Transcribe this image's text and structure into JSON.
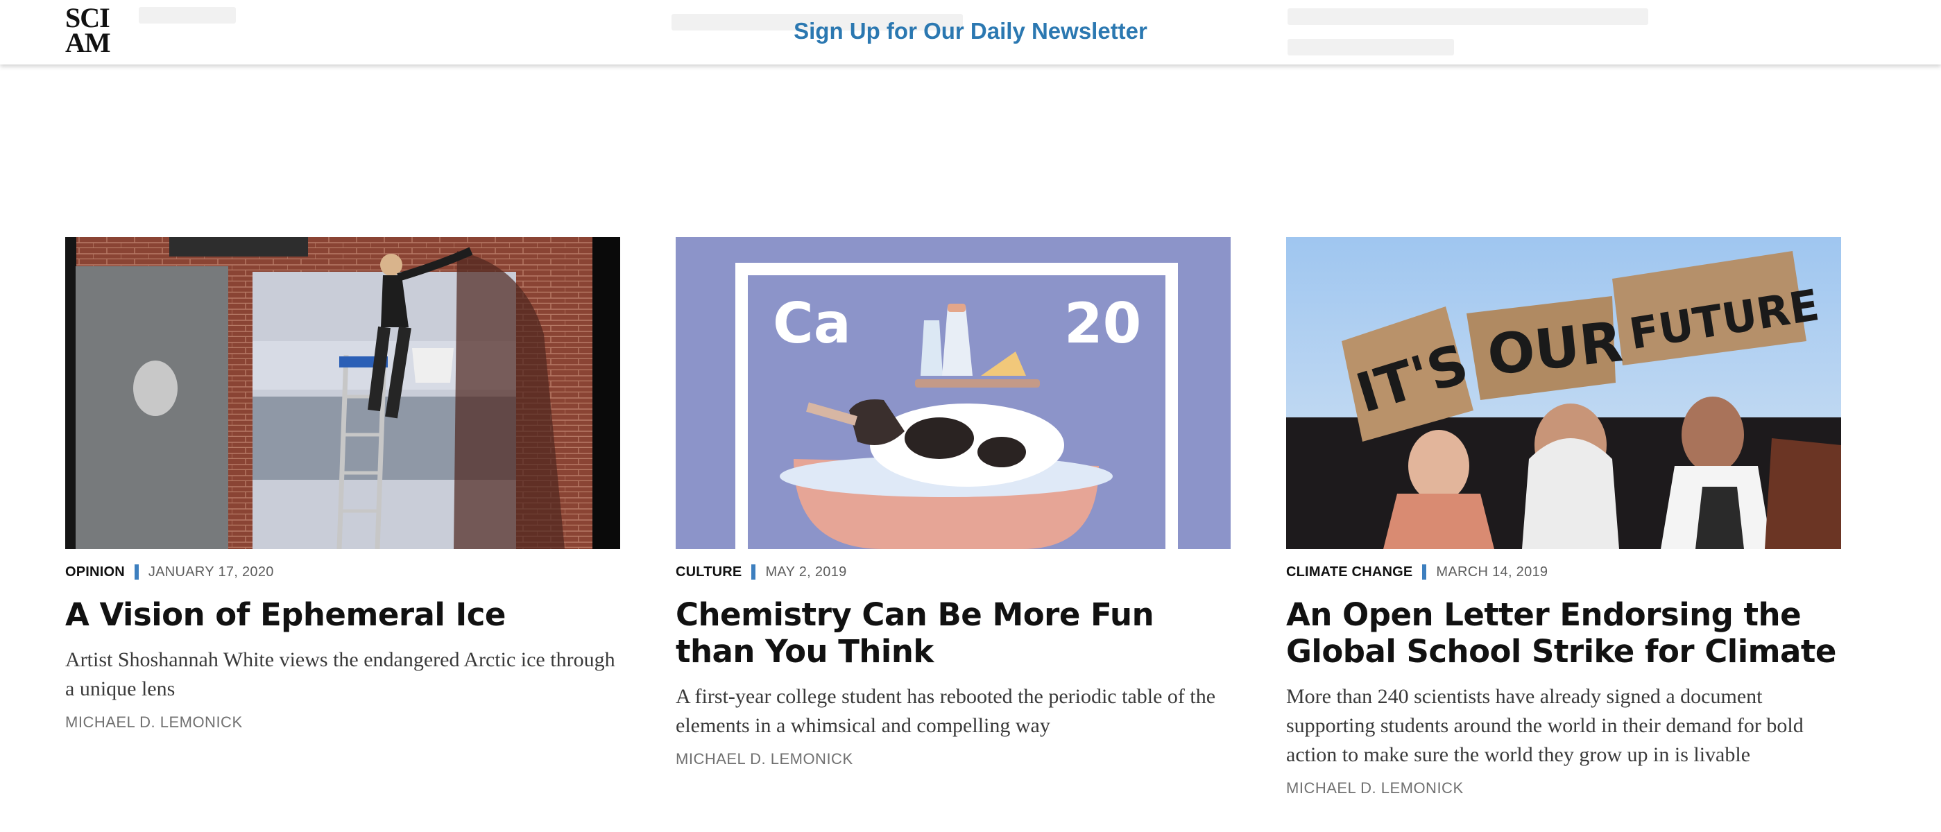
{
  "header": {
    "logo_line1": "SCI",
    "logo_line2": "AM",
    "newsletter_cta": "Sign Up for Our Daily Newsletter"
  },
  "articles": [
    {
      "category": "OPINION",
      "date": "JANUARY 17, 2020",
      "title": "A Vision of Ephemeral Ice",
      "description": "Artist Shoshannah White views the endangered Arctic ice through a unique lens",
      "author": "MICHAEL D. LEMONICK",
      "image": "artist on ladder painting a wall mural of ice"
    },
    {
      "category": "CULTURE",
      "date": "MAY 2, 2019",
      "title": "Chemistry Can Be More Fun than You Think",
      "description": "A first-year college student has rebooted the periodic table of the elements in a whimsical and compelling way",
      "author": "MICHAEL D. LEMONICK",
      "image": "illustrated calcium element tile with cow in bathtub",
      "image_text_symbol": "Ca",
      "image_text_number": "20"
    },
    {
      "category": "CLIMATE CHANGE",
      "date": "MARCH 14, 2019",
      "title": "An Open Letter Endorsing the Global School Strike for Climate",
      "description": "More than 240 scientists have already signed a document supporting students around the world in their demand for bold action to make sure the world they grow up in is livable",
      "author": "MICHAEL D. LEMONICK",
      "image": "students holding cardboard protest signs",
      "sign_1": "IT'S",
      "sign_2": "OUR",
      "sign_3": "FUTURE"
    }
  ],
  "colors": {
    "accent": "#2b78b1",
    "separator": "#3d7fbf",
    "image2_bg": "#8c94c9"
  }
}
